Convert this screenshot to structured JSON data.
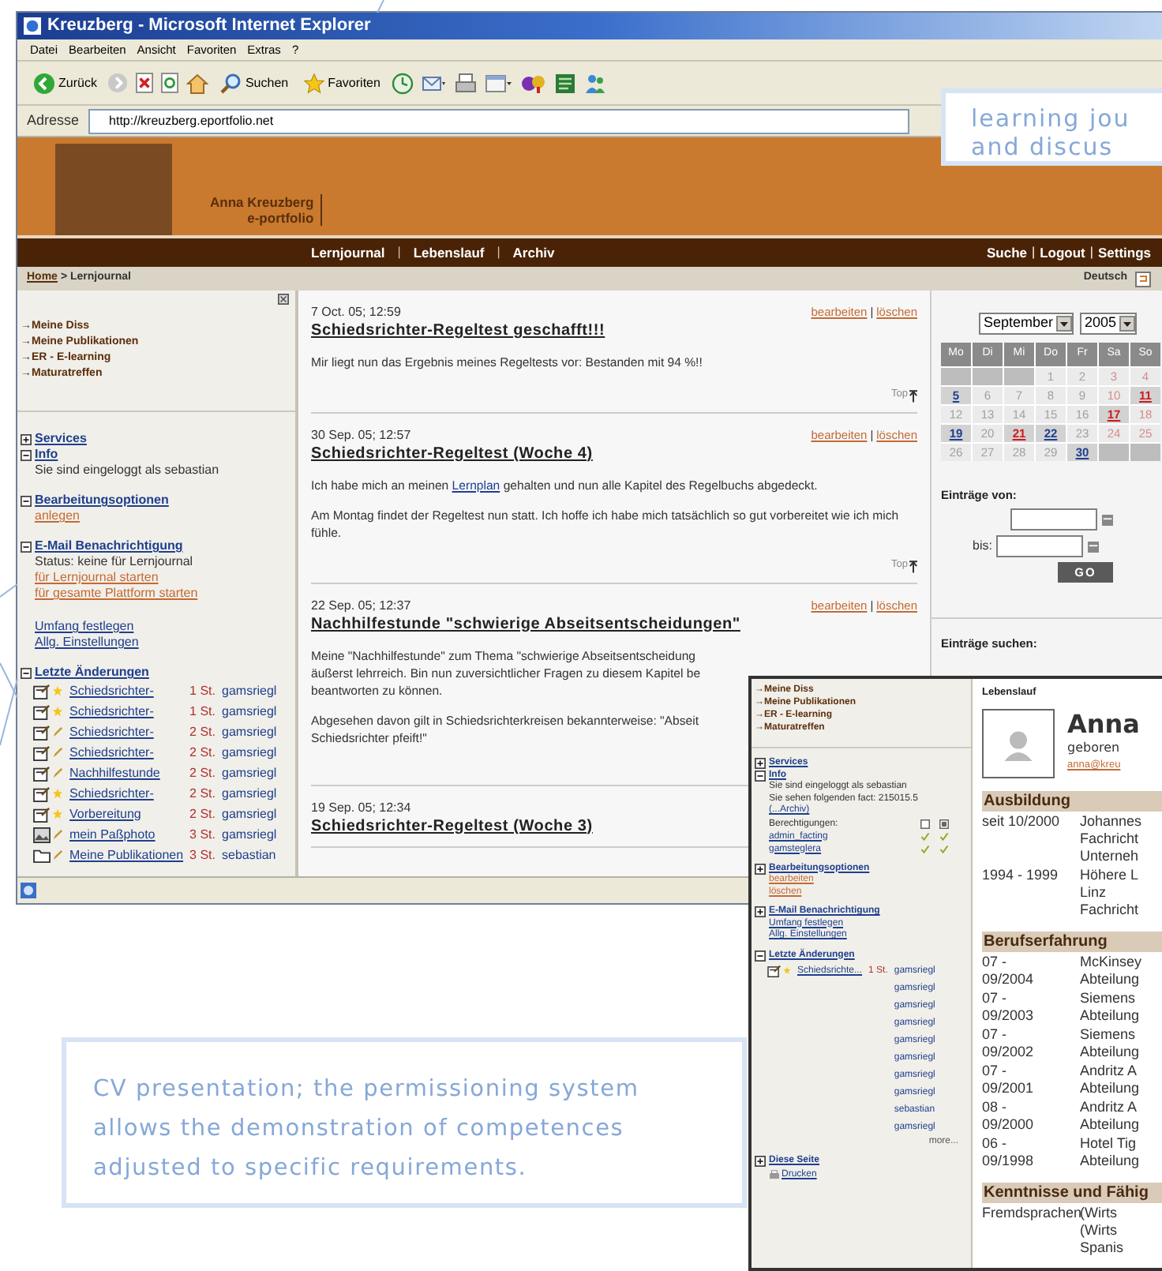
{
  "browser": {
    "title": "Kreuzberg - Microsoft Internet Explorer",
    "menu": [
      "Datei",
      "Bearbeiten",
      "Ansicht",
      "Favoriten",
      "Extras",
      "?"
    ],
    "toolbar": [
      {
        "kind": "back",
        "label": "Zurück"
      },
      {
        "kind": "forward"
      },
      {
        "kind": "stop"
      },
      {
        "kind": "refresh"
      },
      {
        "kind": "home"
      },
      {
        "kind": "search",
        "label": "Suchen"
      },
      {
        "kind": "favorites",
        "label": "Favoriten"
      },
      {
        "kind": "history"
      },
      {
        "kind": "mail"
      },
      {
        "kind": "print"
      },
      {
        "kind": "edit"
      },
      {
        "kind": "messenger"
      },
      {
        "kind": "research"
      },
      {
        "kind": "users"
      }
    ],
    "address_label": "Adresse",
    "address": "http://kreuzberg.eportfolio.net"
  },
  "banner": {
    "name": "Anna Kreuzberg",
    "subtitle": "e-portfolio"
  },
  "nav": {
    "left": [
      {
        "kind": "link",
        "text": "Lernjournal"
      },
      {
        "kind": "separator",
        "text": "|"
      },
      {
        "kind": "link",
        "text": "Lebenslauf"
      },
      {
        "kind": "separator",
        "text": "|"
      },
      {
        "kind": "link",
        "text": "Archiv"
      }
    ],
    "right": [
      {
        "kind": "link",
        "text": "Suche"
      },
      {
        "kind": "separator",
        "text": "|"
      },
      {
        "kind": "link",
        "text": "Logout"
      },
      {
        "kind": "separator",
        "text": "|"
      },
      {
        "kind": "link",
        "text": "Settings"
      }
    ]
  },
  "breadcrumb": {
    "home": "Home",
    "current": "> Lernjournal",
    "language": "Deutsch"
  },
  "sidebar": {
    "quick_links": [
      "→Meine Diss",
      "→Meine Publikationen",
      "→ER - E-learning",
      "→Maturatreffen"
    ],
    "sections": [
      {
        "title": "Services",
        "expanded": false
      },
      {
        "title": "Info",
        "expanded": true,
        "items": [
          {
            "kind": "text",
            "text": "Sie sind eingeloggt als sebastian"
          }
        ]
      },
      {
        "title": "Bearbeitungsoptionen",
        "expanded": true,
        "items": [
          {
            "kind": "action",
            "text": "anlegen"
          }
        ]
      },
      {
        "title": "E-Mail Benachrichtigung",
        "expanded": true,
        "items": [
          {
            "kind": "text",
            "text": "Status: keine für Lernjournal"
          },
          {
            "kind": "action",
            "text": "für Lernjournal starten"
          },
          {
            "kind": "action",
            "text": "für gesamte Plattform starten"
          },
          {
            "kind": "link",
            "text": "Umfang festlegen"
          },
          {
            "kind": "link",
            "text": "Allg. Einstellungen"
          }
        ]
      },
      {
        "title": "Letzte Änderungen",
        "expanded": true,
        "changes": [
          {
            "kind": "journal",
            "new": true,
            "title": "Schiedsrichter-",
            "age": "1 St.",
            "user": "gamsriegl"
          },
          {
            "kind": "journal",
            "new": true,
            "title": "Schiedsrichter-",
            "age": "1 St.",
            "user": "gamsriegl"
          },
          {
            "kind": "journal",
            "new": false,
            "title": "Schiedsrichter-",
            "age": "2 St.",
            "user": "gamsriegl"
          },
          {
            "kind": "journal",
            "new": false,
            "title": "Schiedsrichter-",
            "age": "2 St.",
            "user": "gamsriegl"
          },
          {
            "kind": "journal",
            "new": false,
            "title": "Nachhilfestunde",
            "age": "2 St.",
            "user": "gamsriegl"
          },
          {
            "kind": "journal",
            "new": true,
            "title": "Schiedsrichter-",
            "age": "2 St.",
            "user": "gamsriegl"
          },
          {
            "kind": "journal",
            "new": true,
            "title": "Vorbereitung",
            "age": "2 St.",
            "user": "gamsriegl"
          },
          {
            "kind": "image",
            "new": false,
            "title": "mein Paßphoto",
            "age": "3 St.",
            "user": "gamsriegl"
          },
          {
            "kind": "folder",
            "new": false,
            "title": "Meine Publikationen",
            "age": "3 St.",
            "user": "sebastian"
          }
        ]
      }
    ]
  },
  "journal": [
    {
      "date": "7 Oct. 05; 12:59",
      "title": "Schiedsrichter-Regeltest geschafft!!!",
      "paragraphs": [
        [
          {
            "kind": "text",
            "text": "Mir liegt nun das Ergebnis meines Regeltests vor: Bestanden mit 94 %!!"
          }
        ]
      ],
      "actions": [
        {
          "kind": "link",
          "text": "bearbeiten"
        },
        {
          "kind": "separator",
          "text": "|"
        },
        {
          "kind": "link",
          "text": "löschen"
        }
      ],
      "top": "Top"
    },
    {
      "date": "30 Sep. 05; 12:57",
      "title": "Schiedsrichter-Regeltest (Woche 4)",
      "paragraphs": [
        [
          {
            "kind": "text",
            "text": "Ich habe mich an meinen "
          },
          {
            "kind": "link",
            "text": "Lernplan"
          },
          {
            "kind": "text",
            "text": " gehalten und nun alle Kapitel des Regelbuchs abgedeckt."
          }
        ],
        [
          {
            "kind": "text",
            "text": "Am Montag findet der Regeltest nun statt. Ich hoffe ich habe mich tatsächlich so gut vorbereitet wie ich mich fühle."
          }
        ]
      ],
      "actions": [
        {
          "kind": "link",
          "text": "bearbeiten"
        },
        {
          "kind": "separator",
          "text": "|"
        },
        {
          "kind": "link",
          "text": "löschen"
        }
      ],
      "top": "Top"
    },
    {
      "date": "22 Sep. 05; 12:37",
      "title": "Nachhilfestunde \"schwierige Abseitsentscheidungen\"",
      "paragraphs": [
        [
          {
            "kind": "text",
            "text": "Meine \"Nachhilfestunde\" zum Thema \"schwierige Abseitsentscheidung\näußerst lehrreich. Bin nun zuversichtlicher Fragen zu diesem Kapitel be\nbeantworten zu können."
          }
        ],
        [
          {
            "kind": "text",
            "text": "Abgesehen davon gilt in Schiedsrichterkreisen bekannterweise: \"Abseit\nSchiedsrichter pfeift!\""
          }
        ]
      ],
      "actions": [
        {
          "kind": "link",
          "text": "bearbeiten"
        },
        {
          "kind": "separator",
          "text": "|"
        },
        {
          "kind": "link",
          "text": "löschen"
        }
      ]
    },
    {
      "date": "19 Sep. 05; 12:34",
      "title": "Schiedsrichter-Regeltest (Woche 3)"
    }
  ],
  "calendar": {
    "month": "September",
    "year": "2005",
    "weekdays": [
      "Mo",
      "Di",
      "Mi",
      "Do",
      "Fr",
      "Sa",
      "So"
    ],
    "weeks": [
      [
        {
          "kind": "blank"
        },
        {
          "kind": "blank"
        },
        {
          "kind": "blank"
        },
        {
          "day": "1",
          "kind": "day"
        },
        {
          "day": "2",
          "kind": "day"
        },
        {
          "day": "3",
          "kind": "weekend"
        },
        {
          "day": "4",
          "kind": "weekend"
        }
      ],
      [
        {
          "day": "5",
          "kind": "entry"
        },
        {
          "day": "6",
          "kind": "day"
        },
        {
          "day": "7",
          "kind": "day"
        },
        {
          "day": "8",
          "kind": "day"
        },
        {
          "day": "9",
          "kind": "day"
        },
        {
          "day": "10",
          "kind": "weekend"
        },
        {
          "day": "11",
          "kind": "marked"
        }
      ],
      [
        {
          "day": "12",
          "kind": "day"
        },
        {
          "day": "13",
          "kind": "day"
        },
        {
          "day": "14",
          "kind": "day"
        },
        {
          "day": "15",
          "kind": "day"
        },
        {
          "day": "16",
          "kind": "day"
        },
        {
          "day": "17",
          "kind": "marked"
        },
        {
          "day": "18",
          "kind": "weekend"
        }
      ],
      [
        {
          "day": "19",
          "kind": "entry"
        },
        {
          "day": "20",
          "kind": "day"
        },
        {
          "day": "21",
          "kind": "marked"
        },
        {
          "day": "22",
          "kind": "entry"
        },
        {
          "day": "23",
          "kind": "day"
        },
        {
          "day": "24",
          "kind": "weekend"
        },
        {
          "day": "25",
          "kind": "weekend"
        }
      ],
      [
        {
          "day": "26",
          "kind": "day"
        },
        {
          "day": "27",
          "kind": "day"
        },
        {
          "day": "28",
          "kind": "day"
        },
        {
          "day": "29",
          "kind": "day"
        },
        {
          "day": "30",
          "kind": "entry"
        },
        {
          "kind": "blank"
        },
        {
          "kind": "blank"
        }
      ]
    ]
  },
  "range": {
    "from_label": "Einträge von:",
    "to_label": "bis:",
    "button": "GO"
  },
  "search_label": "Einträge suchen:",
  "cv_window": {
    "sidebar": {
      "quick_links": [
        "→Meine Diss",
        "→Meine Publikationen",
        "→ER - E-learning",
        "→Maturatreffen"
      ],
      "sections": [
        {
          "title": "Services",
          "expanded": false
        },
        {
          "title": "Info",
          "expanded": true,
          "items": [
            {
              "kind": "text",
              "text": "Sie sind eingeloggt als sebastian"
            },
            {
              "kind": "text",
              "text": "Sie sehen folgenden fact: 215015.5"
            },
            {
              "kind": "link",
              "text": "(...Archiv)"
            },
            {
              "kind": "permissions",
              "text": "Berechtigungen:",
              "users": [
                {
                  "name": "admin_facting",
                  "read": true,
                  "write": true
                },
                {
                  "name": "gamsteglera",
                  "read": true,
                  "write": true
                }
              ]
            }
          ]
        },
        {
          "title": "Bearbeitungsoptionen",
          "expanded": false,
          "items": [
            {
              "kind": "action",
              "text": "bearbeiten"
            },
            {
              "kind": "action",
              "text": "löschen"
            }
          ]
        },
        {
          "title": "E-Mail Benachrichtigung",
          "expanded": false,
          "items": [
            {
              "kind": "link",
              "text": "Umfang festlegen"
            },
            {
              "kind": "link",
              "text": "Allg. Einstellungen"
            }
          ]
        },
        {
          "title": "Letzte Änderungen",
          "expanded": true,
          "changes": [
            {
              "kind": "journal",
              "new": true,
              "title": "Schiedsrichte...",
              "age": "1 St.",
              "user": "gamsriegl"
            },
            {
              "user": "gamsriegl"
            },
            {
              "user": "gamsriegl"
            },
            {
              "user": "gamsriegl"
            },
            {
              "user": "gamsriegl"
            },
            {
              "user": "gamsriegl"
            },
            {
              "user": "gamsriegl"
            },
            {
              "user": "gamsriegl"
            },
            {
              "user": "sebastian"
            },
            {
              "user": "gamsriegl"
            }
          ],
          "more": "more..."
        },
        {
          "title": "Diese Seite",
          "expanded": false,
          "items": [
            {
              "kind": "print",
              "text": "Drucken"
            }
          ]
        }
      ]
    },
    "heading": "Lebenslauf",
    "name": "Anna",
    "born": "geboren",
    "email": "anna@kreu",
    "sections": [
      {
        "title": "Ausbildung",
        "rows": [
          {
            "period": "seit 10/2000",
            "lines": [
              "Johannes",
              "Fachricht",
              "Unterneh"
            ]
          },
          {
            "period": "1994 - 1999",
            "lines": [
              "Höhere L",
              "Linz",
              "Fachricht"
            ]
          }
        ]
      },
      {
        "title": "Berufserfahrung",
        "rows": [
          {
            "period": "07 -\n09/2004",
            "lines": [
              "McKinsey",
              "Abteilung"
            ]
          },
          {
            "period": "07 -\n09/2003",
            "lines": [
              "Siemens",
              "Abteilung"
            ]
          },
          {
            "period": "07 -\n09/2002",
            "lines": [
              "Siemens",
              "Abteilung"
            ]
          },
          {
            "period": "07 -\n09/2001",
            "lines": [
              "Andritz A",
              "Abteilung"
            ]
          },
          {
            "period": "08 -\n09/2000",
            "lines": [
              "Andritz A",
              "Abteilung"
            ]
          },
          {
            "period": "06 -\n09/1998",
            "lines": [
              "Hotel Tig",
              "Abteilung"
            ]
          }
        ]
      },
      {
        "title": "Kenntnisse und Fähig",
        "rows": [
          {
            "period": "Fremdsprachen",
            "lines": [
              "(Wirts",
              "(Wirts",
              "Spanis"
            ]
          }
        ]
      }
    ]
  },
  "callouts": [
    {
      "text": "learning jou\nand discus"
    },
    {
      "text": "CV presentation; the permissioning system\nallows the demonstration of competences\nadjusted to specific requirements."
    }
  ]
}
